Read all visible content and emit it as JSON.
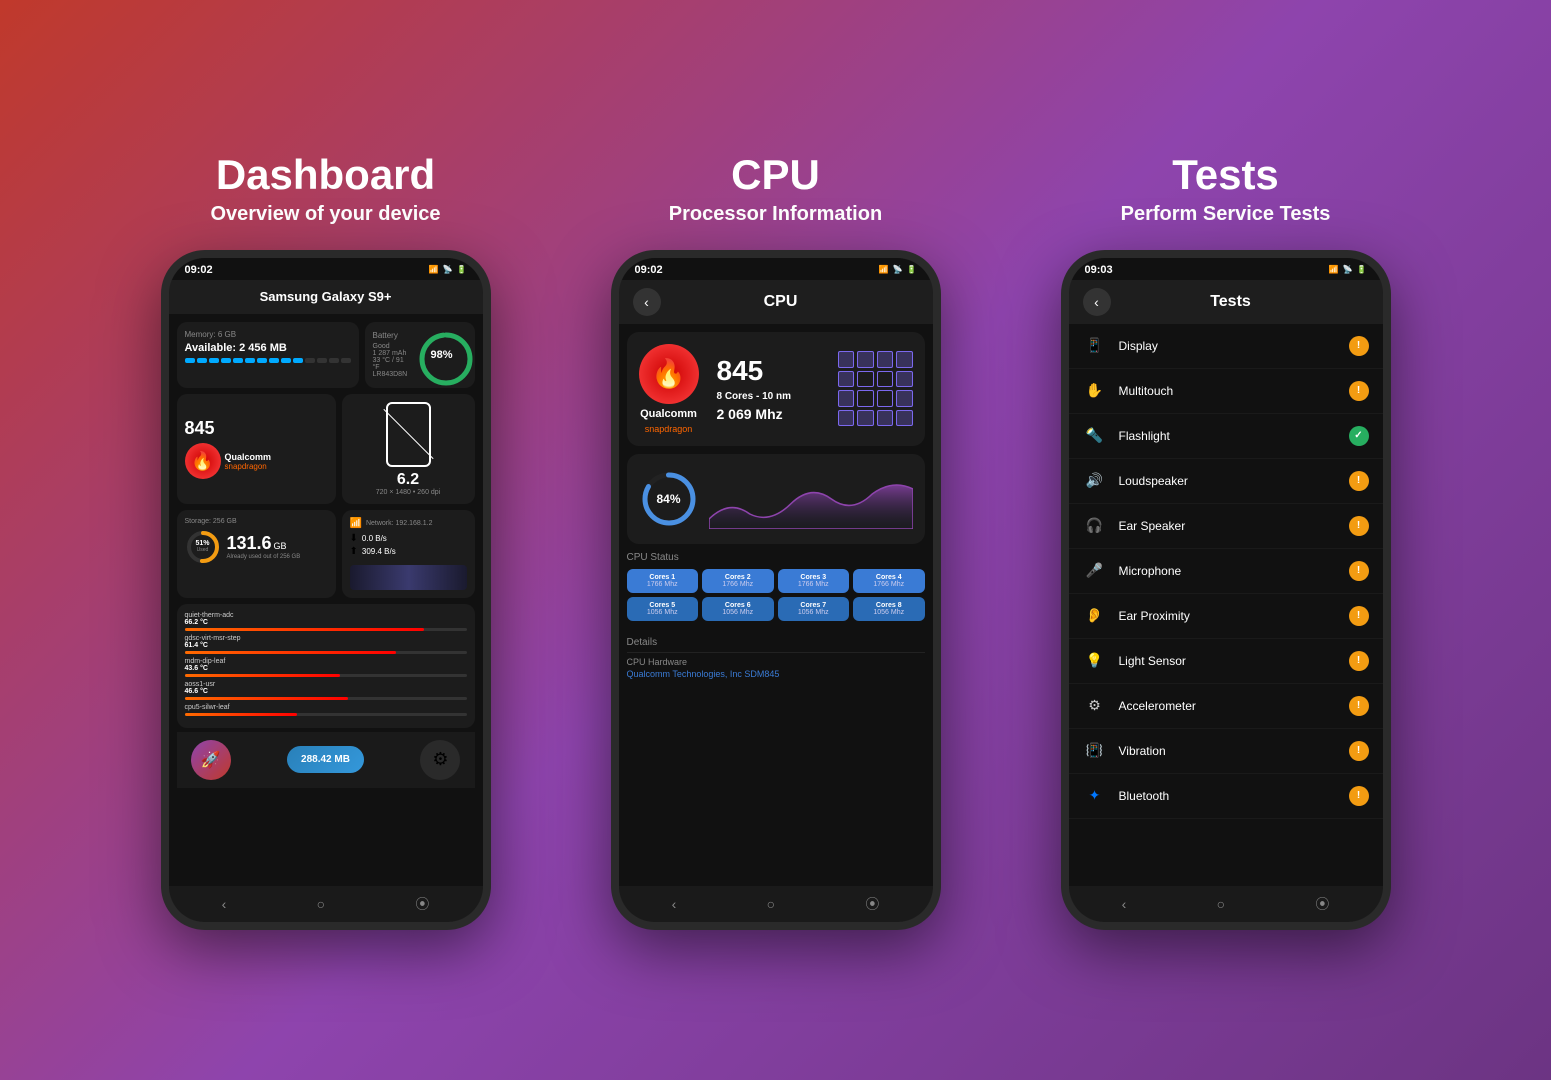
{
  "page": {
    "background": "gradient purple-red"
  },
  "panel1": {
    "title": "Dashboard",
    "subtitle": "Overview of your device",
    "phone": {
      "time": "09:02",
      "device_name": "Samsung Galaxy S9+",
      "memory": {
        "label": "Memory: 6 GB",
        "value": "Available: 2 456 MB",
        "dots_filled": 10,
        "dots_empty": 4
      },
      "battery": {
        "label": "Battery",
        "percent": "98%",
        "status": "Good",
        "health": "1 287 mAh",
        "temp": "33 °C / 91 °F",
        "id": "LR843D8N"
      },
      "cpu": {
        "model": "845",
        "brand": "Qualcomm",
        "sub": "snapdragon"
      },
      "screen": {
        "size": "6.2",
        "res": "720 × 1480 • 260 dpi"
      },
      "storage": {
        "label": "Storage: 256 GB",
        "used_pct": "51%",
        "used_label": "Used",
        "size": "131.6",
        "unit": "GB",
        "already_used": "Already used out of 256 GB"
      },
      "network": {
        "ip": "Network: 192.168.1.2",
        "download": "0.0 B/s",
        "upload": "309.4 B/s"
      },
      "temps": [
        {
          "name": "quiet-therm-adc",
          "value": "66.2 °C",
          "bar": 85
        },
        {
          "name": "gdsc-virt-msr-step",
          "value": "61.4 °C",
          "bar": 75
        },
        {
          "name": "mdm-dip-leaf",
          "value": "43.6 °C",
          "bar": 55
        },
        {
          "name": "aoss1-usr",
          "value": "46.6 °C",
          "bar": 58
        },
        {
          "name": "cpu5-silwr-leaf",
          "value": "",
          "bar": 40
        }
      ],
      "ram_btn": "288.42 MB",
      "nav": [
        "‹",
        "○",
        "⦿"
      ]
    }
  },
  "panel2": {
    "title": "CPU",
    "subtitle": "Processor Information",
    "phone": {
      "time": "09:02",
      "back_btn": "‹",
      "header_title": "CPU",
      "chip_model": "845",
      "brand": "Qualcomm",
      "sub": "snapdragon",
      "cores": "8 Cores - 10 nm",
      "freq_mhz": "2 069 Mhz",
      "usage_pct": "84%",
      "cpu_status_label": "CPU Status",
      "cores_data": [
        {
          "name": "Cores 1",
          "freq": "1766 Mhz"
        },
        {
          "name": "Cores 2",
          "freq": "1766 Mhz"
        },
        {
          "name": "Cores 3",
          "freq": "1766 Mhz"
        },
        {
          "name": "Cores 4",
          "freq": "1766 Mhz"
        },
        {
          "name": "Cores 5",
          "freq": "1056 Mhz"
        },
        {
          "name": "Cores 6",
          "freq": "1056 Mhz"
        },
        {
          "name": "Cores 7",
          "freq": "1056 Mhz"
        },
        {
          "name": "Cores 8",
          "freq": "1056 Mhz"
        }
      ],
      "details_label": "Details",
      "detail_section": "CPU Hardware",
      "detail_value": "Qualcomm Technologies, Inc SDM845",
      "nav": [
        "‹",
        "○",
        "⦿"
      ]
    }
  },
  "panel3": {
    "title": "Tests",
    "subtitle": "Perform Service Tests",
    "phone": {
      "time": "09:03",
      "back_btn": "‹",
      "header_title": "Tests",
      "tests": [
        {
          "name": "Display",
          "icon": "📱",
          "badge_type": "orange",
          "badge": "!"
        },
        {
          "name": "Multitouch",
          "icon": "✋",
          "badge_type": "orange",
          "badge": "!"
        },
        {
          "name": "Flashlight",
          "icon": "🔦",
          "badge_type": "green",
          "badge": "✓"
        },
        {
          "name": "Loudspeaker",
          "icon": "🔊",
          "badge_type": "orange",
          "badge": "!"
        },
        {
          "name": "Ear Speaker",
          "icon": "🎧",
          "badge_type": "orange",
          "badge": "!"
        },
        {
          "name": "Microphone",
          "icon": "🎤",
          "badge_type": "orange",
          "badge": "!"
        },
        {
          "name": "Ear Proximity",
          "icon": "👂",
          "badge_type": "orange",
          "badge": "!"
        },
        {
          "name": "Light Sensor",
          "icon": "💡",
          "badge_type": "orange",
          "badge": "!"
        },
        {
          "name": "Accelerometer",
          "icon": "⚙",
          "badge_type": "orange",
          "badge": "!"
        },
        {
          "name": "Vibration",
          "icon": "📳",
          "badge_type": "orange",
          "badge": "!"
        },
        {
          "name": "Bluetooth",
          "icon": "🦷",
          "badge_type": "orange",
          "badge": "!"
        }
      ],
      "nav": [
        "‹",
        "○",
        "⦿"
      ]
    }
  }
}
